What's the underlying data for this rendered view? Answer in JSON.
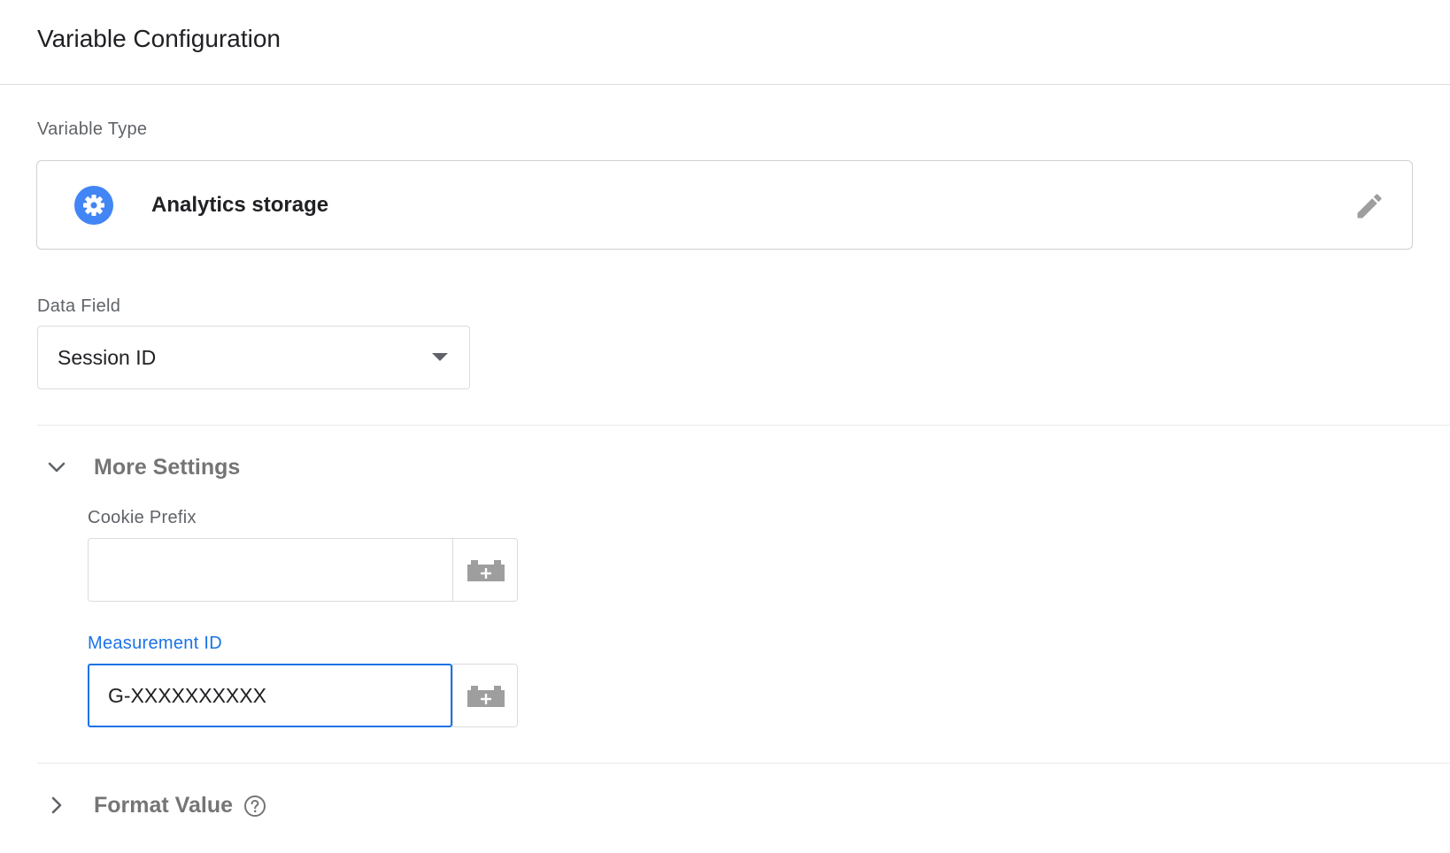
{
  "panel": {
    "title": "Variable Configuration"
  },
  "variable_type": {
    "label": "Variable Type",
    "name": "Analytics storage",
    "icon": "gear-icon",
    "edit_icon": "pencil-icon"
  },
  "data_field": {
    "label": "Data Field",
    "selected": "Session ID"
  },
  "more_settings": {
    "title": "More Settings",
    "expanded": true,
    "cookie_prefix": {
      "label": "Cookie Prefix",
      "value": "",
      "placeholder": ""
    },
    "measurement_id": {
      "label": "Measurement ID",
      "value": "G-XXXXXXXXXX"
    },
    "variable_picker_icon": "add-variable-icon"
  },
  "format_value": {
    "title": "Format Value",
    "expanded": false,
    "help_icon": "help-icon"
  },
  "colors": {
    "accent": "#1a73e8",
    "icon_blue": "#4285f4",
    "muted_icon": "#9e9e9e",
    "border": "#dadce0"
  }
}
